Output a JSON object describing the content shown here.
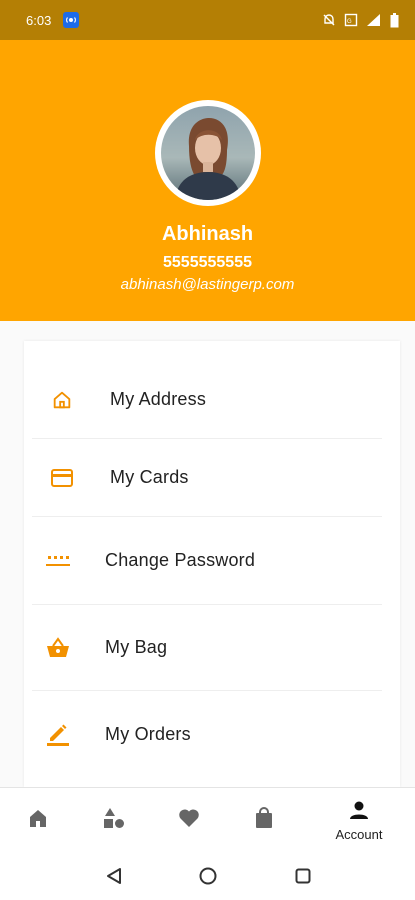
{
  "status_bar": {
    "time": "6:03",
    "icons": [
      "cast-icon",
      "mute-icon",
      "data-saver-icon",
      "signal-icon",
      "battery-icon"
    ]
  },
  "profile": {
    "name": "Abhinash",
    "phone": "5555555555",
    "email": "abhinash@lastingerp.com"
  },
  "colors": {
    "primary": "#ffa500",
    "status_bar": "#b47f05",
    "icon_accent": "#f29100"
  },
  "menu": [
    {
      "label": "My Address",
      "icon": "home-outline-icon"
    },
    {
      "label": "My Cards",
      "icon": "credit-card-icon"
    },
    {
      "label": "Change Password",
      "icon": "password-icon"
    },
    {
      "label": "My Bag",
      "icon": "shopping-basket-icon"
    },
    {
      "label": "My Orders",
      "icon": "edit-icon"
    }
  ],
  "bottom_nav": {
    "items": [
      {
        "icon": "home-icon",
        "label": ""
      },
      {
        "icon": "category-icon",
        "label": ""
      },
      {
        "icon": "heart-icon",
        "label": ""
      },
      {
        "icon": "shopping-bag-icon",
        "label": ""
      },
      {
        "icon": "person-icon",
        "label": "Account"
      }
    ]
  }
}
